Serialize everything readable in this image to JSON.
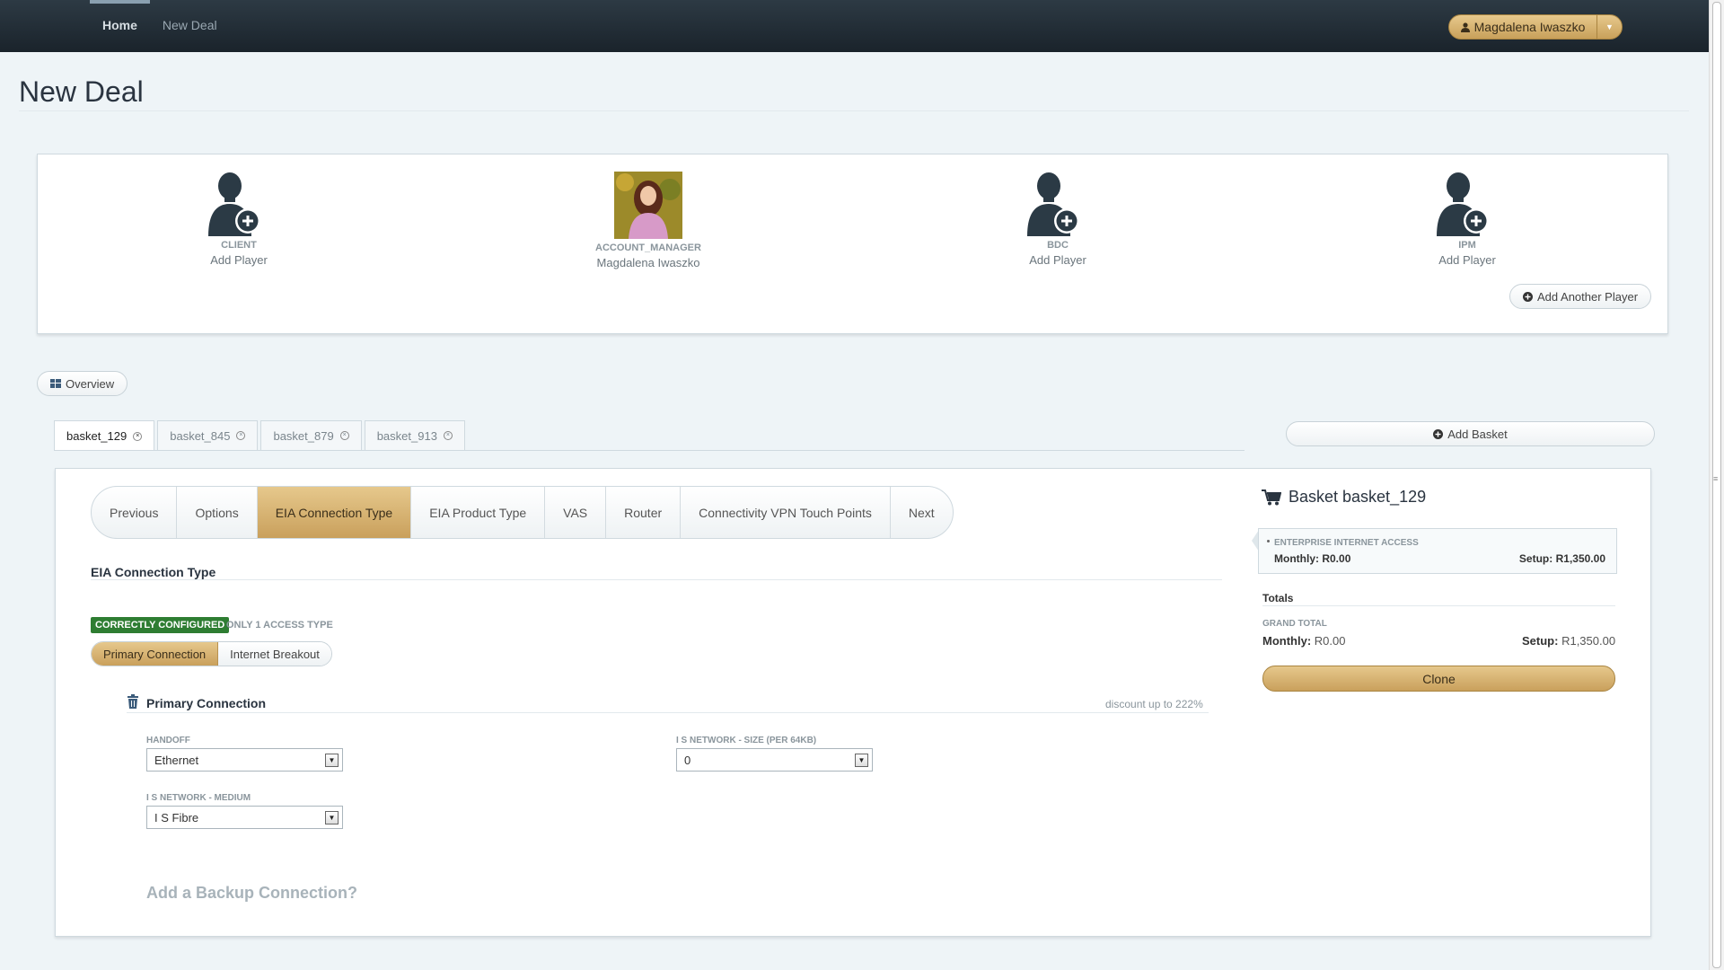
{
  "nav": {
    "items": [
      {
        "label": "Home",
        "active": true
      },
      {
        "label": "New Deal",
        "active": false
      }
    ]
  },
  "user": {
    "name": "Magdalena Iwaszko"
  },
  "page": {
    "title": "New Deal"
  },
  "players": [
    {
      "role": "CLIENT",
      "name": "Add Player",
      "has_photo": false
    },
    {
      "role": "ACCOUNT_MANAGER",
      "name": "Magdalena Iwaszko",
      "has_photo": true
    },
    {
      "role": "BDC",
      "name": "Add Player",
      "has_photo": false
    },
    {
      "role": "IPM",
      "name": "Add Player",
      "has_photo": false
    }
  ],
  "buttons": {
    "add_another_player": "Add Another Player",
    "overview": "Overview",
    "add_basket": "Add Basket",
    "clone": "Clone"
  },
  "baskets": {
    "tabs": [
      "basket_129",
      "basket_845",
      "basket_879",
      "basket_913"
    ],
    "active": "basket_129"
  },
  "wizard": {
    "steps": [
      "Previous",
      "Options",
      "EIA Connection Type",
      "EIA Product Type",
      "VAS",
      "Router",
      "Connectivity VPN Touch Points",
      "Next"
    ],
    "active": "EIA Connection Type"
  },
  "section": {
    "title": "EIA Connection Type",
    "status_badge": "CORRECTLY CONFIGURED",
    "note": "ONLY 1 ACCESS TYPE"
  },
  "connection_toggle": {
    "options": [
      "Primary Connection",
      "Internet Breakout"
    ],
    "active": "Primary Connection"
  },
  "primary": {
    "title": "Primary Connection",
    "discount": "discount up to 222%",
    "fields": {
      "handoff": {
        "label": "HANDOFF",
        "value": "Ethernet"
      },
      "size": {
        "label": "I S NETWORK - SIZE (PER 64KB)",
        "value": "0"
      },
      "medium": {
        "label": "I S NETWORK - MEDIUM",
        "value": "I S Fibre"
      }
    }
  },
  "backup_link": "Add a Backup Connection?",
  "basket_summary": {
    "title": "Basket basket_129",
    "item": {
      "name": "ENTERPRISE INTERNET ACCESS",
      "monthly_label": "Monthly:",
      "monthly": "R0.00",
      "setup_label": "Setup:",
      "setup": "R1,350.00"
    },
    "totals_label": "Totals",
    "grand_total_label": "GRAND TOTAL",
    "monthly_label": "Monthly:",
    "monthly": "R0.00",
    "setup_label": "Setup:",
    "setup": "R1,350.00"
  },
  "colors": {
    "accent": "#c9a05c",
    "topbar": "#1a232b",
    "success": "#2e7d32"
  }
}
